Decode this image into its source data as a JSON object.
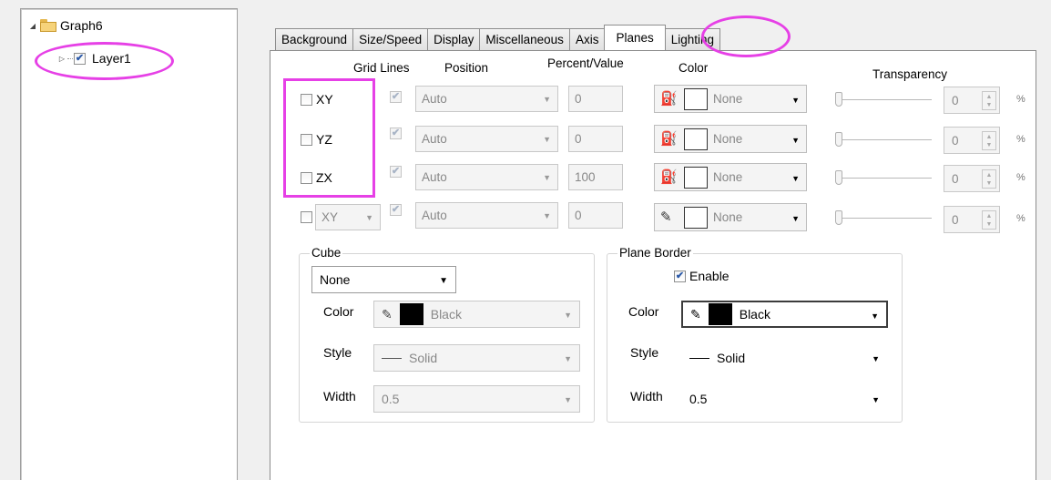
{
  "tree": {
    "root": {
      "label": "Graph6",
      "expander": "◢"
    },
    "child": {
      "label": "Layer1",
      "checked": true,
      "expander": "▷"
    }
  },
  "tabs": [
    "Background",
    "Size/Speed",
    "Display",
    "Miscellaneous",
    "Axis",
    "Planes",
    "Lighting"
  ],
  "active_tab": "Planes",
  "headers": {
    "grid_lines": "Grid Lines",
    "position": "Position",
    "percent_value": "Percent/Value",
    "color": "Color",
    "transparency": "Transparency"
  },
  "planes": [
    {
      "name": "XY",
      "position": "Auto",
      "value": "0",
      "color": "None",
      "transparency": "0",
      "pct": "%"
    },
    {
      "name": "YZ",
      "position": "Auto",
      "value": "0",
      "color": "None",
      "transparency": "0",
      "pct": "%"
    },
    {
      "name": "ZX",
      "position": "Auto",
      "value": "100",
      "color": "None",
      "transparency": "0",
      "pct": "%"
    },
    {
      "name": "XY",
      "position": "Auto",
      "value": "0",
      "color": "None",
      "transparency": "0",
      "pct": "%"
    }
  ],
  "cube": {
    "title": "Cube",
    "type": "None",
    "color_label": "Color",
    "color": "Black",
    "style_label": "Style",
    "style": "Solid",
    "width_label": "Width",
    "width": "0.5"
  },
  "plane_border": {
    "title": "Plane Border",
    "enable_label": "Enable",
    "enabled": true,
    "color_label": "Color",
    "color": "Black",
    "style_label": "Style",
    "style": "Solid",
    "width_label": "Width",
    "width": "0.5"
  },
  "colors": {
    "highlight": "#e640e6",
    "check_blue": "#2c5aa8"
  },
  "icons": {
    "fill": "paint-bucket-icon",
    "pen": "pen-icon"
  }
}
